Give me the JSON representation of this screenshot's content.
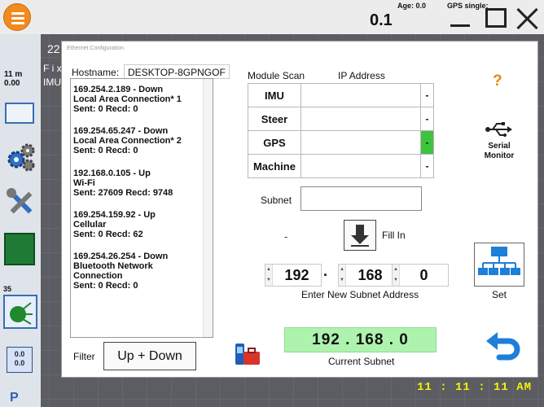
{
  "app": {
    "speed": "0.1",
    "age_label": "Age: 0.0",
    "gps_label": "GPS single:",
    "distance_unit": "11 m",
    "distance_value": "0.00",
    "section_count": "35",
    "field_values": [
      "0.0",
      "0.0"
    ],
    "bg_text_1": "22",
    "bg_text_2": "F i x",
    "bg_text_3": "IMU",
    "p_label": "P",
    "clock": "11 : 11 : 11  AM"
  },
  "dialog": {
    "title": "Ethernet Configuration",
    "hostname_label": "Hostname:",
    "hostname": "DESKTOP-8GPNGOF",
    "interfaces": [
      {
        "line1": "169.254.2.189  - Down",
        "line2": "Local Area Connection* 1",
        "stats": "Sent: 0   Recd: 0"
      },
      {
        "line1": "169.254.65.247  - Down",
        "line2": "Local Area Connection* 2",
        "stats": "Sent: 0   Recd: 0"
      },
      {
        "line1": "192.168.0.105  - Up",
        "line2": "Wi-Fi",
        "stats": "Sent: 27609   Recd: 9748"
      },
      {
        "line1": "169.254.159.92  - Up",
        "line2": "Cellular",
        "stats": "Sent: 0   Recd: 62"
      },
      {
        "line1": "169.254.26.254  - Down",
        "line2": "Bluetooth Network",
        "line3": "Connection",
        "stats": "Sent: 0   Recd: 0"
      }
    ],
    "filter_label": "Filter",
    "filter_button": "Up + Down",
    "module_scan_label": "Module Scan",
    "ip_address_label": "IP Address",
    "modules": [
      {
        "name": "IMU",
        "ip": "",
        "status": "-",
        "status_color": "#ffffff"
      },
      {
        "name": "Steer",
        "ip": "",
        "status": "-",
        "status_color": "#ffffff"
      },
      {
        "name": "GPS",
        "ip": "",
        "status": "-",
        "status_color": "#3ec33e"
      },
      {
        "name": "Machine",
        "ip": "",
        "status": "-",
        "status_color": "#ffffff"
      }
    ],
    "subnet_label": "Subnet",
    "subnet_value": "",
    "dash": "-",
    "fill_in_label": "Fill In",
    "octets": [
      "192",
      "168",
      "0"
    ],
    "enter_subnet_label": "Enter New Subnet Address",
    "current_subnet": "192 . 168 . 0",
    "current_subnet_label": "Current Subnet",
    "serial_monitor_label": "Serial Monitor",
    "set_label": "Set",
    "help_glyph": "?",
    "colors": {
      "current_subnet_bg": "#adf3ad",
      "accent_blue": "#1e7fd8",
      "help_orange": "#e58a10"
    }
  }
}
